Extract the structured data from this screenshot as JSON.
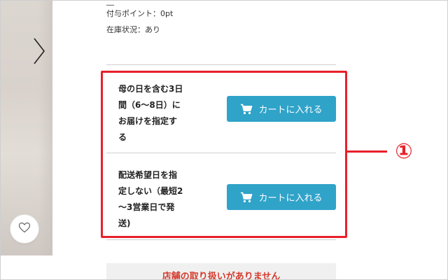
{
  "product": {
    "cut_top_text": "__",
    "points_text": "付与ポイント：0pt",
    "stock_text": "在庫状況：あり"
  },
  "delivery_options": [
    {
      "label_lines": [
        "母の日を含む3日",
        "間（6〜8日）に",
        "お届けを指定す",
        "る"
      ],
      "button_label": "カートに入れる",
      "button_icon": "cart-icon"
    },
    {
      "label_lines": [
        "配送希望日を指",
        "定しない（最短2",
        "〜3営業日で発",
        "送)"
      ],
      "button_label": "カートに入れる",
      "button_icon": "cart-icon"
    }
  ],
  "annotation": {
    "number": "①",
    "color": "#e8202a"
  },
  "notice": {
    "text": "店舗の取り扱いがありません"
  },
  "colors": {
    "button": "#30a3c9",
    "notice_text": "#d53a2c"
  },
  "icons": {
    "prev": "chevron-right-icon",
    "favorite": "heart-icon"
  }
}
